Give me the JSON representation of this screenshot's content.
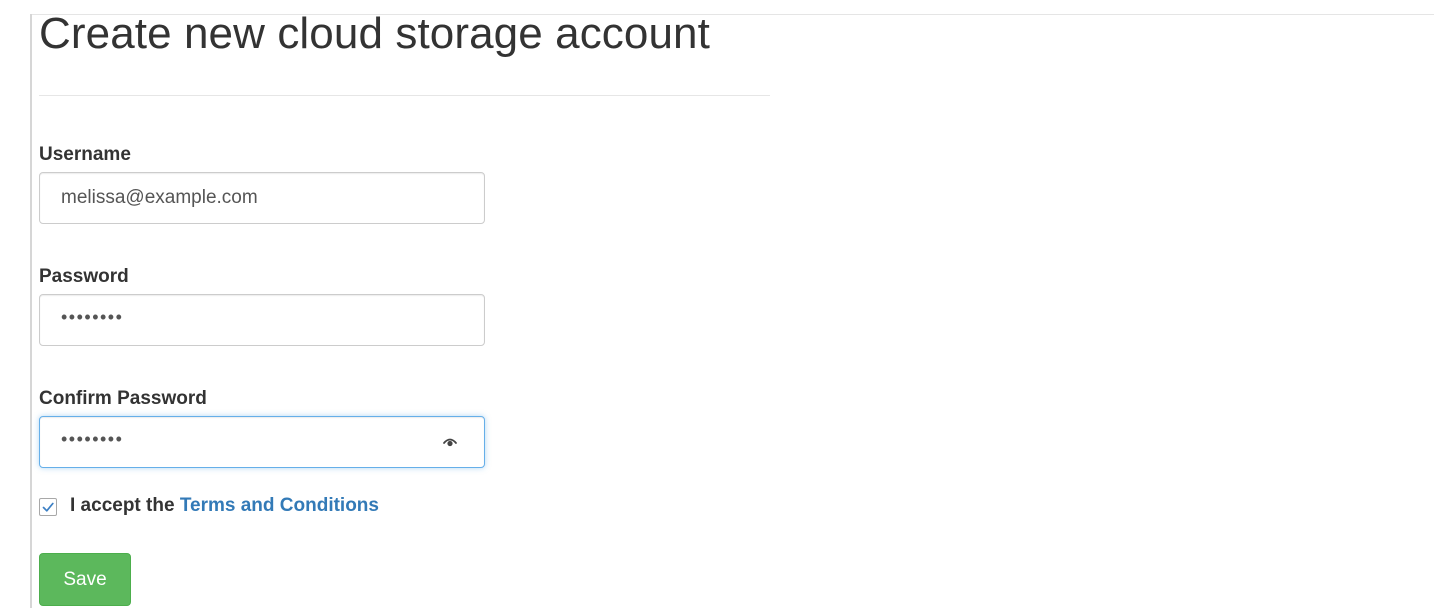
{
  "page": {
    "title": "Create new cloud storage account"
  },
  "form": {
    "username": {
      "label": "Username",
      "value": "melissa@example.com"
    },
    "password": {
      "label": "Password",
      "masked_value": "••••••••"
    },
    "confirm_password": {
      "label": "Confirm Password",
      "masked_value": "••••••••",
      "reveal_icon": "eye-icon"
    },
    "terms": {
      "checked": true,
      "prefix": "I accept the",
      "link_text": "Terms and Conditions"
    },
    "save_label": "Save"
  },
  "colors": {
    "primary_link": "#337ab7",
    "save_button": "#5cb85c",
    "focus_border": "#66afe9",
    "checkbox_check": "#3b7fc4"
  }
}
